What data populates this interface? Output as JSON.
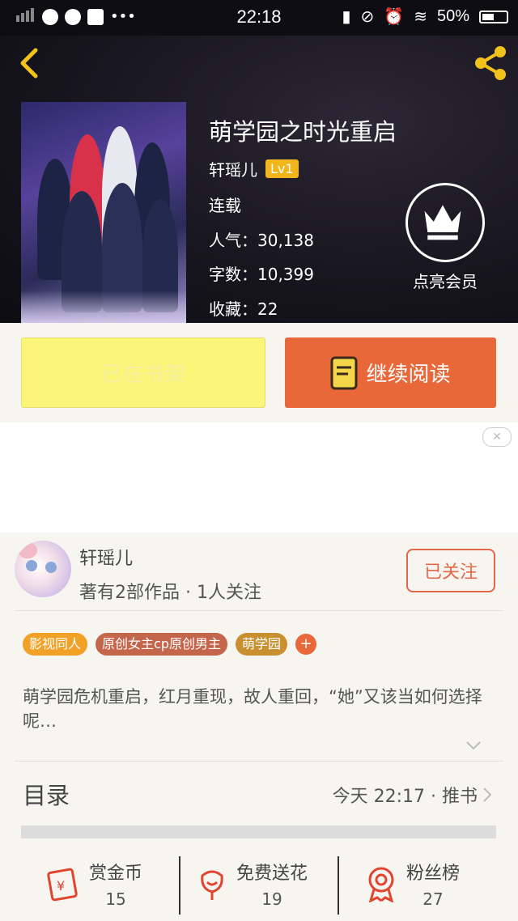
{
  "status_bar": {
    "time": "22:18",
    "battery": "50%"
  },
  "book": {
    "title": "萌学园之时光重启",
    "author": "轩瑶儿",
    "level": "Lv1",
    "status": "连载",
    "popularity_label": "人气：",
    "popularity": "30,138",
    "words_label": "字数：",
    "words": "10,399",
    "favorites_label": "收藏：",
    "favorites": "22"
  },
  "vip": {
    "label": "点亮会员"
  },
  "actions": {
    "shelf_label": "已在书架",
    "read_label": "继续阅读"
  },
  "author_card": {
    "name": "轩瑶儿",
    "stats": "著有2部作品 · 1人关注",
    "follow_label": "已关注"
  },
  "tags": [
    {
      "label": "影视同人",
      "color": "#f0a126"
    },
    {
      "label": "原创女主cp原创男主",
      "color": "#c4664c"
    },
    {
      "label": "萌学园",
      "color": "#c99032"
    }
  ],
  "tag_add": "+",
  "description": "萌学园危机重启，红月重现，故人重回，“她”又该当如何选择呢…",
  "toc": {
    "title": "目录",
    "updated": "今天 22:17 · 推书"
  },
  "bottom": [
    {
      "label": "赏金币",
      "value": "15"
    },
    {
      "label": "免费送花",
      "value": "19"
    },
    {
      "label": "粉丝榜",
      "value": "27"
    }
  ],
  "colors": {
    "accent": "#e9683a",
    "shelf_button": "#fbf57a",
    "level_badge": "#f2b51c"
  }
}
